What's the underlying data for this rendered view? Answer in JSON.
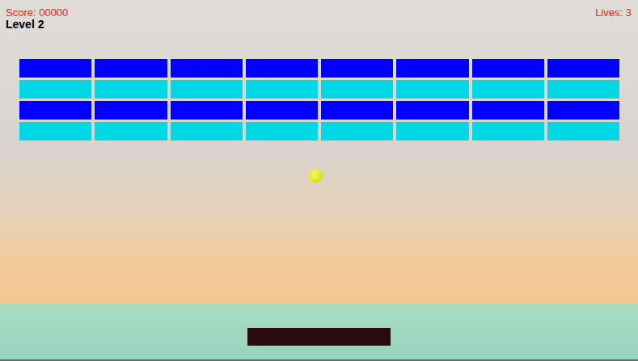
{
  "hud": {
    "score": "Score: 00000",
    "lives": "Lives: 3",
    "level": "Level 2"
  },
  "brick_rows": [
    {
      "color": "#0000ff",
      "bricks": [
        {
          "intact": true
        },
        {
          "intact": true
        },
        {
          "intact": true
        },
        {
          "intact": true
        },
        {
          "intact": true
        },
        {
          "intact": true
        },
        {
          "intact": true
        },
        {
          "intact": true
        }
      ]
    },
    {
      "color": "#00d8e6",
      "bricks": [
        {
          "intact": true
        },
        {
          "intact": true
        },
        {
          "intact": true
        },
        {
          "intact": true
        },
        {
          "intact": true
        },
        {
          "intact": true
        },
        {
          "intact": true
        },
        {
          "intact": true
        }
      ]
    },
    {
      "color": "#0000ff",
      "bricks": [
        {
          "intact": true
        },
        {
          "intact": true
        },
        {
          "intact": true
        },
        {
          "intact": true
        },
        {
          "intact": true
        },
        {
          "intact": true
        },
        {
          "intact": true
        },
        {
          "intact": true
        }
      ]
    },
    {
      "color": "#00d8e6",
      "bricks": [
        {
          "intact": true
        },
        {
          "intact": true
        },
        {
          "intact": true
        },
        {
          "intact": true
        },
        {
          "intact": true
        },
        {
          "intact": true
        },
        {
          "intact": true
        },
        {
          "intact": true
        }
      ]
    }
  ]
}
